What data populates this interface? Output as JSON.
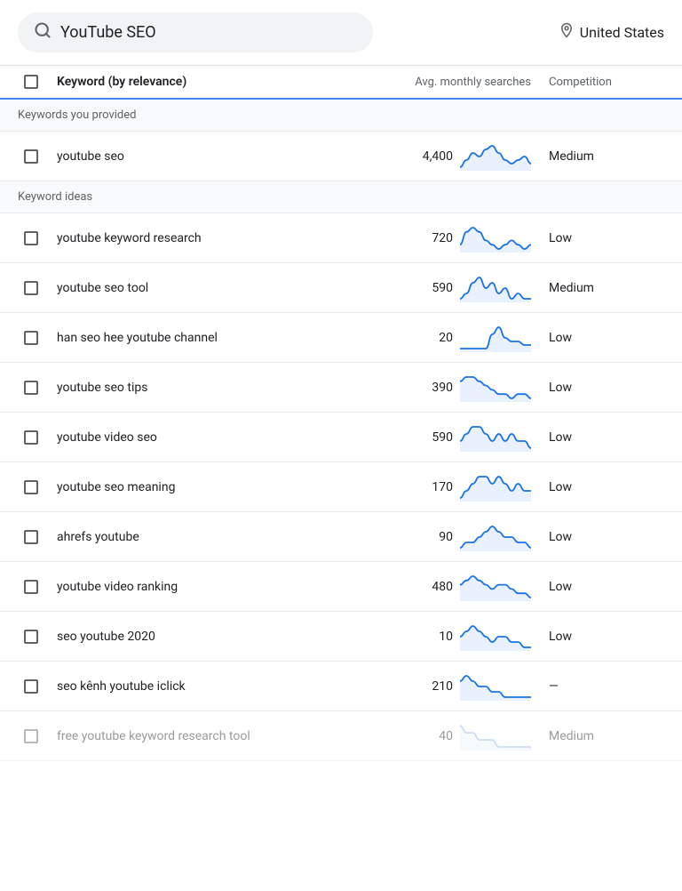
{
  "searchBar": {
    "query": "YouTube SEO",
    "location": "United States",
    "searchIconLabel": "search",
    "locationIconLabel": "location pin"
  },
  "table": {
    "headers": {
      "keyword": "Keyword (by relevance)",
      "avgMonthlySearches": "Avg. monthly searches",
      "competition": "Competition"
    },
    "sectionProvided": "Keywords you provided",
    "sectionIdeas": "Keyword ideas",
    "providedKeywords": [
      {
        "keyword": "youtube seo",
        "searches": "4,400",
        "competition": "Medium",
        "sparklineData": [
          3,
          5,
          7,
          6,
          8,
          9,
          7,
          5,
          4,
          5,
          6,
          4
        ]
      }
    ],
    "ideaKeywords": [
      {
        "keyword": "youtube keyword research",
        "searches": "720",
        "competition": "Low",
        "sparklineData": [
          4,
          7,
          8,
          7,
          5,
          4,
          3,
          4,
          5,
          4,
          3,
          4
        ]
      },
      {
        "keyword": "youtube seo tool",
        "searches": "590",
        "competition": "Medium",
        "sparklineData": [
          3,
          4,
          6,
          7,
          5,
          6,
          4,
          5,
          3,
          4,
          3,
          3
        ]
      },
      {
        "keyword": "han seo hee youtube channel",
        "searches": "20",
        "competition": "Low",
        "sparklineData": [
          2,
          2,
          2,
          2,
          2,
          6,
          8,
          5,
          4,
          4,
          3,
          3
        ]
      },
      {
        "keyword": "youtube seo tips",
        "searches": "390",
        "competition": "Low",
        "sparklineData": [
          7,
          8,
          8,
          7,
          6,
          5,
          4,
          4,
          3,
          4,
          4,
          3
        ]
      },
      {
        "keyword": "youtube video seo",
        "searches": "590",
        "competition": "Low",
        "sparklineData": [
          4,
          5,
          6,
          6,
          5,
          4,
          5,
          4,
          5,
          4,
          4,
          3
        ]
      },
      {
        "keyword": "youtube seo meaning",
        "searches": "170",
        "competition": "Low",
        "sparklineData": [
          3,
          4,
          5,
          6,
          6,
          5,
          6,
          5,
          4,
          5,
          4,
          4
        ]
      },
      {
        "keyword": "ahrefs youtube",
        "searches": "90",
        "competition": "Low",
        "sparklineData": [
          3,
          4,
          4,
          5,
          6,
          7,
          6,
          5,
          5,
          4,
          4,
          3
        ]
      },
      {
        "keyword": "youtube video ranking",
        "searches": "480",
        "competition": "Low",
        "sparklineData": [
          5,
          6,
          7,
          6,
          5,
          4,
          5,
          5,
          4,
          3,
          3,
          2
        ]
      },
      {
        "keyword": "seo youtube 2020",
        "searches": "10",
        "competition": "Low",
        "sparklineData": [
          4,
          5,
          6,
          5,
          4,
          3,
          4,
          4,
          3,
          3,
          2,
          2
        ]
      },
      {
        "keyword": "seo kênh youtube iclick",
        "searches": "210",
        "competition": "—",
        "sparklineData": [
          5,
          6,
          5,
          4,
          4,
          3,
          3,
          2,
          2,
          2,
          2,
          2
        ]
      },
      {
        "keyword": "free youtube keyword research tool",
        "searches": "40",
        "competition": "Medium",
        "sparklineData": [
          5,
          4,
          4,
          3,
          3,
          3,
          2,
          2,
          2,
          2,
          2,
          2
        ],
        "dimmed": true
      }
    ]
  }
}
